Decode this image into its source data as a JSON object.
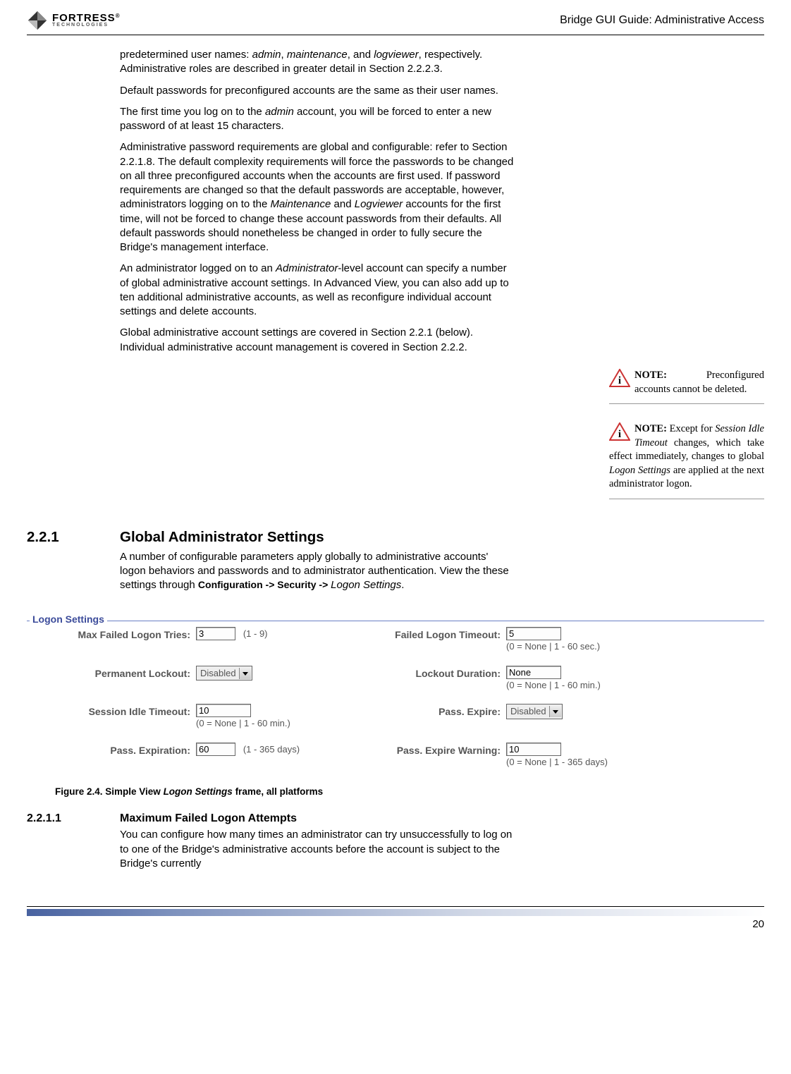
{
  "header": {
    "logo_main": "FORTRESS",
    "logo_sub": "TECHNOLOGIES",
    "title": "Bridge GUI Guide: Administrative Access"
  },
  "body": {
    "p1_prefix": "predetermined user names: ",
    "p1_i1": "admin",
    "p1_m1": ", ",
    "p1_i2": "maintenance",
    "p1_m2": ", and ",
    "p1_i3": "logviewer",
    "p1_suffix": ", respectively. Administrative roles are described in greater detail in Section 2.2.2.3.",
    "p2": "Default passwords for preconfigured accounts are the same as their user names.",
    "p3_a": "The first time you log on to the ",
    "p3_i": "admin",
    "p3_b": " account, you will be forced to enter a new password of at least 15 characters.",
    "p4_a": "Administrative password requirements are global and configurable: refer to Section 2.2.1.8. The default complexity requirements will force the passwords to be changed on all three preconfigured accounts when the accounts are first used. If password requirements are changed so that the default passwords are acceptable, however, administrators logging on to the ",
    "p4_i1": "Maintenance",
    "p4_m": " and ",
    "p4_i2": "Logviewer",
    "p4_b": " accounts for the first time, will not be forced to change these account passwords from their defaults. All default passwords should nonetheless be changed in order to fully secure the Bridge's management interface.",
    "p5_a": "An administrator logged on to an ",
    "p5_i": "Administrator",
    "p5_b": "-level account can specify a number of global administrative account settings. In Advanced View, you can also add up to ten additional administrative accounts, as well as reconfigure individual account settings and delete accounts.",
    "p6": "Global administrative account settings are covered in Section 2.2.1 (below). Individual administrative account management is covered in Section 2.2.2."
  },
  "sect221": {
    "num": "2.2.1",
    "title": "Global Administrator Settings",
    "p_a": "A number of configurable parameters apply globally to administrative accounts' logon behaviors and passwords and to administrator authentication. View the these settings through ",
    "nav1": "Configuration -> ",
    "nav2": "Security -> ",
    "nav3": "Logon Settings",
    "period": "."
  },
  "notes": {
    "label": "NOTE:",
    "n1": " Preconfigured accounts cannot be deleted.",
    "n2_a": " Except for ",
    "n2_i": "Session Idle Timeout",
    "n2_b": " changes, which take effect immediately, changes to global ",
    "n2_i2": "Logon Settings",
    "n2_c": " are applied at the next administrator logon."
  },
  "form": {
    "legend": "Logon Settings",
    "max_tries_label": "Max Failed Logon Tries:",
    "max_tries_val": "3",
    "max_tries_range": "(1 - 9)",
    "failed_timeout_label": "Failed Logon Timeout:",
    "failed_timeout_val": "5",
    "failed_timeout_range": "(0 = None | 1 - 60 sec.)",
    "perm_lockout_label": "Permanent Lockout:",
    "perm_lockout_val": "Disabled",
    "lockout_dur_label": "Lockout Duration:",
    "lockout_dur_val": "None",
    "lockout_dur_range": "(0 = None | 1 - 60 min.)",
    "idle_label": "Session Idle Timeout:",
    "idle_val": "10",
    "idle_range": "(0 = None | 1 - 60 min.)",
    "pexp_label": "Pass. Expire:",
    "pexp_val": "Disabled",
    "pexpirn_label": "Pass. Expiration:",
    "pexpirn_val": "60",
    "pexpirn_range": "(1 - 365 days)",
    "pwarn_label": "Pass. Expire Warning:",
    "pwarn_val": "10",
    "pwarn_range": "(0 = None | 1 - 365 days)"
  },
  "figure": {
    "lead": "Figure 2.4.   Simple View ",
    "it": "Logon Settings",
    "tail": " frame, all platforms"
  },
  "sect2211": {
    "num": "2.2.1.1",
    "title": "Maximum Failed Logon Attempts",
    "p": "You can configure how many times an administrator can try unsuccessfully to log on to one of the Bridge's administrative accounts before the account is subject to the Bridge's currently"
  },
  "page_number": "20"
}
